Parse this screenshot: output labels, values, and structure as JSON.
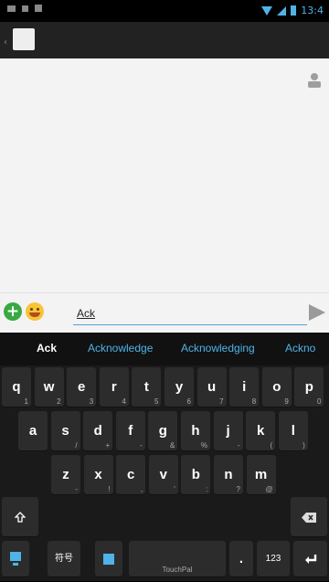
{
  "status": {
    "time": "13:4"
  },
  "compose": {
    "message_text": "Ack"
  },
  "suggestions": [
    "Ack",
    "Acknowledge",
    "Acknowledging",
    "Ackno"
  ],
  "keyboard": {
    "row1": [
      {
        "k": "q",
        "s": "1"
      },
      {
        "k": "w",
        "s": "2"
      },
      {
        "k": "e",
        "s": "3"
      },
      {
        "k": "r",
        "s": "4"
      },
      {
        "k": "t",
        "s": "5"
      },
      {
        "k": "y",
        "s": "6"
      },
      {
        "k": "u",
        "s": "7"
      },
      {
        "k": "i",
        "s": "8"
      },
      {
        "k": "o",
        "s": "9"
      },
      {
        "k": "p",
        "s": "0"
      }
    ],
    "row2": [
      {
        "k": "a",
        "s": ""
      },
      {
        "k": "s",
        "s": "/"
      },
      {
        "k": "d",
        "s": "+"
      },
      {
        "k": "f",
        "s": "-"
      },
      {
        "k": "g",
        "s": "&"
      },
      {
        "k": "h",
        "s": "%"
      },
      {
        "k": "j",
        "s": "-"
      },
      {
        "k": "k",
        "s": "("
      },
      {
        "k": "l",
        "s": ")"
      }
    ],
    "row3": [
      {
        "k": "z",
        "s": "-"
      },
      {
        "k": "x",
        "s": "!"
      },
      {
        "k": "c",
        "s": ","
      },
      {
        "k": "v",
        "s": "'"
      },
      {
        "k": "b",
        "s": ":"
      },
      {
        "k": "n",
        "s": "?"
      },
      {
        "k": "m",
        "s": "@"
      }
    ],
    "symbol_label": "符号",
    "numbers_label": "123",
    "space_brand": "TouchPal",
    "period": "."
  },
  "colors": {
    "accent": "#4fb3e8",
    "plus": "#3aa843",
    "key": "#2c2c2c"
  }
}
